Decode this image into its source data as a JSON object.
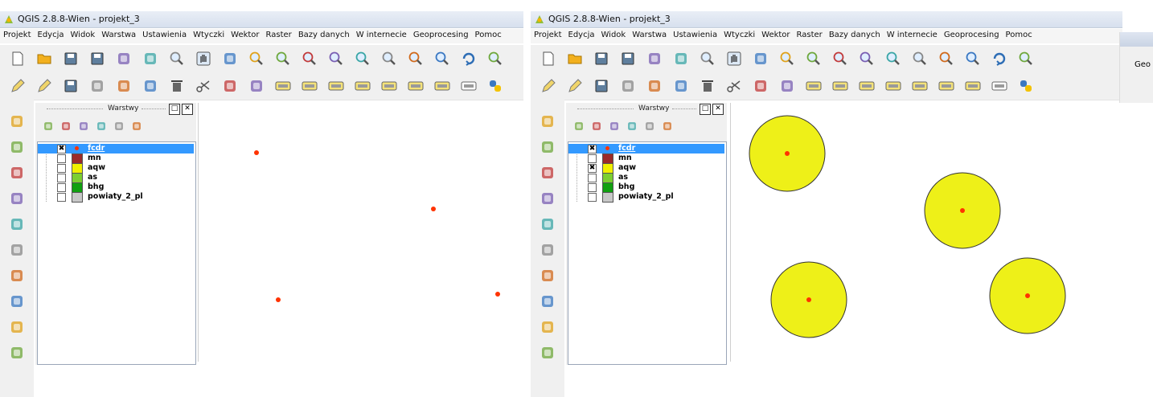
{
  "windows": [
    {
      "title": "QGIS 2.8.8-Wien - projekt_3",
      "menu": [
        "Projekt",
        "Edycja",
        "Widok",
        "Warstwa",
        "Ustawienia",
        "Wtyczki",
        "Wektor",
        "Raster",
        "Bazy danych",
        "W internecie",
        "Geoprocesing",
        "Pomoc"
      ],
      "panel_title": "Warstwy",
      "layers": [
        {
          "name": "fcdr",
          "checked": true,
          "selected": true,
          "swatch": "#ff3300",
          "kind": "point"
        },
        {
          "name": "mn",
          "checked": false,
          "selected": false,
          "swatch": "#9b2a2a",
          "kind": "fill"
        },
        {
          "name": "aqw",
          "checked": false,
          "selected": false,
          "swatch": "#f0f000",
          "kind": "fill"
        },
        {
          "name": "as",
          "checked": false,
          "selected": false,
          "swatch": "#7ccf31",
          "kind": "fill"
        },
        {
          "name": "bhg",
          "checked": false,
          "selected": false,
          "swatch": "#10a010",
          "kind": "fill"
        },
        {
          "name": "powiaty_2_pl",
          "checked": false,
          "selected": false,
          "swatch": "#c8c8c8",
          "kind": "fill"
        }
      ]
    },
    {
      "title": "QGIS 2.8.8-Wien - projekt_3",
      "menu": [
        "Projekt",
        "Edycja",
        "Widok",
        "Warstwa",
        "Ustawienia",
        "Wtyczki",
        "Wektor",
        "Raster",
        "Bazy danych",
        "W internecie",
        "Geoprocesing",
        "Pomoc"
      ],
      "panel_title": "Warstwy",
      "layers": [
        {
          "name": "fcdr",
          "checked": true,
          "selected": true,
          "swatch": "#ff3300",
          "kind": "point"
        },
        {
          "name": "mn",
          "checked": false,
          "selected": false,
          "swatch": "#9b2a2a",
          "kind": "fill"
        },
        {
          "name": "aqw",
          "checked": true,
          "selected": false,
          "swatch": "#f0f000",
          "kind": "fill"
        },
        {
          "name": "as",
          "checked": false,
          "selected": false,
          "swatch": "#7ccf31",
          "kind": "fill"
        },
        {
          "name": "bhg",
          "checked": false,
          "selected": false,
          "swatch": "#10a010",
          "kind": "fill"
        },
        {
          "name": "powiaty_2_pl",
          "checked": false,
          "selected": false,
          "swatch": "#c8c8c8",
          "kind": "fill"
        }
      ]
    }
  ],
  "overflow_menu_fragment": "Geo",
  "colors": {
    "point": "#ff3300",
    "buffer_fill": "#eef018",
    "buffer_stroke": "#333333",
    "selection": "#3399ff"
  },
  "icons": {
    "toolbar1": [
      "new-project-icon",
      "open-project-icon",
      "save-project-icon",
      "save-as-icon",
      "print-composer-icon",
      "composer-manager-icon",
      "touch-zoom-icon",
      "pan-hand-icon",
      "pan-to-selection-icon",
      "zoom-in-icon",
      "zoom-out-icon",
      "zoom-native-icon",
      "zoom-full-icon",
      "zoom-to-selection-icon",
      "zoom-to-layer-icon",
      "zoom-last-icon",
      "zoom-next-icon",
      "refresh-icon",
      "identify-icon"
    ],
    "toolbar2": [
      "current-edits-icon",
      "toggle-editing-icon",
      "save-edits-icon",
      "add-feature-icon",
      "move-feature-icon",
      "node-tool-icon",
      "delete-selected-icon",
      "cut-features-icon",
      "copy-features-icon",
      "paste-features-icon",
      "label-toolbar-icon",
      "layer-labeling-icon",
      "pin-labels-icon",
      "show-hide-labels-icon",
      "move-label-icon",
      "rotate-label-icon",
      "change-label-icon",
      "csw-icon",
      "python-icon"
    ],
    "left": [
      "add-vector-layer-icon",
      "add-raster-layer-icon",
      "add-postgis-layer-icon",
      "add-spatialite-layer-icon",
      "add-mssql-layer-icon",
      "add-oracle-layer-icon",
      "add-db2-layer-icon",
      "add-wms-layer-icon",
      "add-wcs-layer-icon",
      "add-wfs-layer-icon"
    ]
  }
}
